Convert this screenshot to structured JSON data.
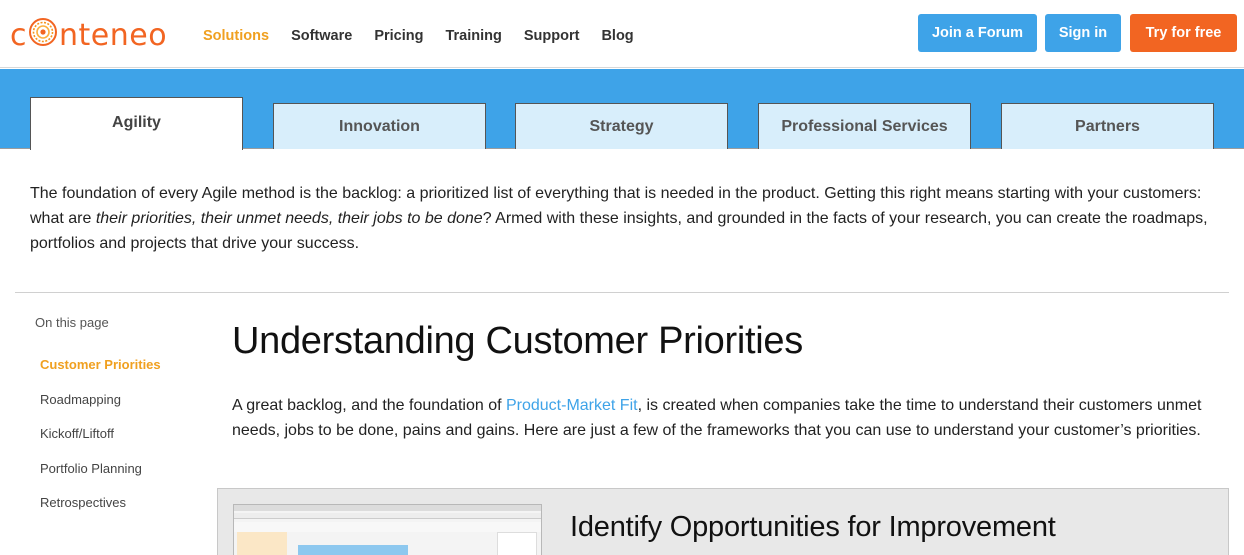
{
  "brand": {
    "name_before": "c",
    "name_after": "nteneo",
    "color": "#f26522"
  },
  "nav": {
    "items": [
      "Solutions",
      "Software",
      "Pricing",
      "Training",
      "Support",
      "Blog"
    ],
    "active_index": 0
  },
  "header_buttons": {
    "forum": "Join a Forum",
    "signin": "Sign in",
    "try": "Try for free"
  },
  "tabs": {
    "items": [
      "Agility",
      "Innovation",
      "Strategy",
      "Professional Services",
      "Partners"
    ],
    "active_index": 0
  },
  "intro": {
    "part1": "The foundation of every Agile method is the backlog: a prioritized list of everything that is needed in the product. Getting this right means starting with your customers: what are ",
    "emphasis": "their priorities, their unmet needs, their jobs to be done",
    "part2": "? Armed with these insights, and grounded in the facts of your research, you can create the roadmaps, portfolios and projects that drive your success."
  },
  "sidebar": {
    "heading": "On this page",
    "items": [
      "Customer Priorities",
      "Roadmapping",
      "Kickoff/Liftoff",
      "Portfolio Planning",
      "Retrospectives"
    ],
    "active_index": 0
  },
  "main": {
    "title": "Understanding Customer Priorities",
    "para_before": "A great backlog, and the foundation of ",
    "para_link": "Product-Market Fit",
    "para_after": ", is created when companies take the time to understand their customers unmet needs, jobs to be done, pains and gains. Here are just a few of the frameworks that you can use to understand your customer’s priorities."
  },
  "card": {
    "title": "Identify Opportunities for Improvement"
  },
  "colors": {
    "accent_blue": "#3ea3e8",
    "accent_orange": "#f26522",
    "active_yellow": "#f0a020"
  }
}
